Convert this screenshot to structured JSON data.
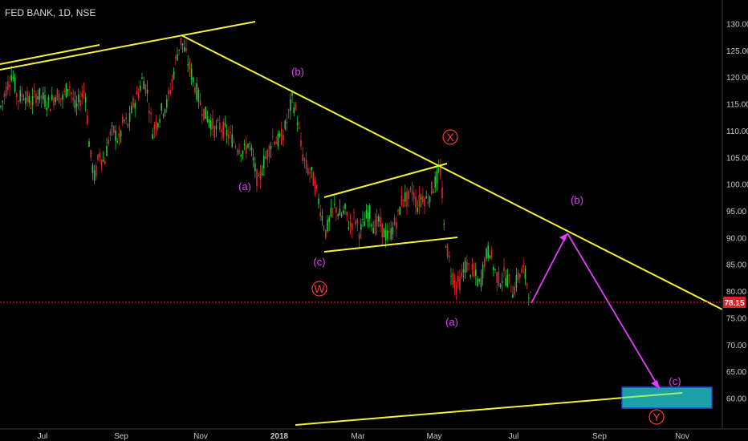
{
  "title": "FED BANK, 1D, NSE",
  "colors": {
    "background": "#000000",
    "bullish": "#26c637",
    "bearish": "#e0262c",
    "trendline": "#f2f23c",
    "projection": "#e040fb",
    "wave_circle": "#ff3b30",
    "target_box_fill": "#1b9fa8",
    "target_box_border": "#1f4fd6",
    "price_badge": "#e51f26"
  },
  "chart_data": {
    "type": "candlestick",
    "title": "FED BANK, 1D, NSE",
    "xlabel": "",
    "ylabel": "",
    "x_tick_labels": [
      "Jul",
      "Sep",
      "Nov",
      "2018",
      "Mar",
      "May",
      "Jul",
      "Sep",
      "Nov"
    ],
    "y_tick_labels": [
      "130.00",
      "125.00",
      "120.00",
      "115.00",
      "110.00",
      "105.00",
      "100.00",
      "95.00",
      "90.00",
      "85.00",
      "80.00",
      "75.00",
      "70.00",
      "65.00",
      "60.00"
    ],
    "ylim": [
      55,
      133
    ],
    "last_price": "78.15",
    "grid": false,
    "price_path": [
      [
        0,
        114
      ],
      [
        8,
        118
      ],
      [
        15,
        121
      ],
      [
        22,
        116
      ],
      [
        30,
        117
      ],
      [
        38,
        115
      ],
      [
        46,
        117
      ],
      [
        54,
        116
      ],
      [
        62,
        115
      ],
      [
        70,
        117
      ],
      [
        78,
        116
      ],
      [
        86,
        119
      ],
      [
        94,
        114
      ],
      [
        100,
        116
      ],
      [
        106,
        118
      ],
      [
        112,
        106
      ],
      [
        118,
        101
      ],
      [
        124,
        106
      ],
      [
        130,
        104
      ],
      [
        136,
        109
      ],
      [
        142,
        110
      ],
      [
        148,
        108
      ],
      [
        154,
        112
      ],
      [
        160,
        111
      ],
      [
        166,
        115
      ],
      [
        172,
        117
      ],
      [
        178,
        120
      ],
      [
        184,
        117
      ],
      [
        190,
        110
      ],
      [
        196,
        112
      ],
      [
        202,
        114
      ],
      [
        208,
        115
      ],
      [
        214,
        119
      ],
      [
        220,
        124
      ],
      [
        226,
        127
      ],
      [
        232,
        124
      ],
      [
        238,
        121
      ],
      [
        244,
        118
      ],
      [
        250,
        115
      ],
      [
        256,
        113
      ],
      [
        262,
        112
      ],
      [
        268,
        110
      ],
      [
        274,
        111
      ],
      [
        280,
        110
      ],
      [
        286,
        109
      ],
      [
        292,
        108
      ],
      [
        298,
        107
      ],
      [
        304,
        106
      ],
      [
        310,
        108
      ],
      [
        316,
        104
      ],
      [
        322,
        100
      ],
      [
        328,
        104
      ],
      [
        334,
        106
      ],
      [
        340,
        109
      ],
      [
        346,
        108
      ],
      [
        352,
        109
      ],
      [
        358,
        112
      ],
      [
        364,
        116
      ],
      [
        370,
        113
      ],
      [
        376,
        106
      ],
      [
        382,
        103
      ],
      [
        388,
        102
      ],
      [
        394,
        99
      ],
      [
        400,
        95
      ],
      [
        406,
        91
      ],
      [
        412,
        94
      ],
      [
        418,
        96
      ],
      [
        424,
        94
      ],
      [
        430,
        95
      ],
      [
        436,
        92
      ],
      [
        442,
        94
      ],
      [
        448,
        91
      ],
      [
        454,
        93
      ],
      [
        460,
        95
      ],
      [
        466,
        92
      ],
      [
        472,
        93
      ],
      [
        478,
        91
      ],
      [
        484,
        90
      ],
      [
        490,
        92
      ],
      [
        496,
        94
      ],
      [
        502,
        98
      ],
      [
        508,
        97
      ],
      [
        514,
        99
      ],
      [
        520,
        96
      ],
      [
        526,
        98
      ],
      [
        532,
        97
      ],
      [
        538,
        99
      ],
      [
        544,
        101
      ],
      [
        550,
        103
      ],
      [
        552,
        93
      ],
      [
        556,
        89
      ],
      [
        562,
        84
      ],
      [
        568,
        81
      ],
      [
        574,
        82
      ],
      [
        580,
        85
      ],
      [
        586,
        84
      ],
      [
        592,
        83
      ],
      [
        598,
        81
      ],
      [
        604,
        86
      ],
      [
        610,
        88
      ],
      [
        616,
        84
      ],
      [
        622,
        82
      ],
      [
        628,
        83
      ],
      [
        634,
        82
      ],
      [
        640,
        80
      ],
      [
        646,
        83
      ],
      [
        652,
        84
      ],
      [
        658,
        81
      ],
      [
        662,
        78
      ]
    ],
    "trendlines": [
      {
        "from": [
          "Jun '17",
          120.8
        ],
        "to": [
          "Jul '17",
          125.3
        ]
      },
      {
        "from": [
          "Jun '17",
          122.4
        ],
        "to": [
          "Oct '17",
          131.0
        ]
      },
      {
        "from": [
          "Oct '17",
          128.0
        ],
        "to": [
          "Dec '18",
          76.8
        ]
      },
      {
        "from": [
          "Feb '18",
          97.5
        ],
        "to": [
          "May '18",
          104.5
        ]
      },
      {
        "from": [
          "Feb '18",
          87.5
        ],
        "to": [
          "May '18",
          90.3
        ]
      },
      {
        "from": [
          "Jan '18",
          55.0
        ],
        "to": [
          "Oct '18",
          61.0
        ]
      }
    ],
    "projection": [
      {
        "date": "Jul '18",
        "price": 78.15
      },
      {
        "date": "Aug '18",
        "price": 91.0
      },
      {
        "date": "Oct '18",
        "price": 61.0
      }
    ],
    "target_zone": {
      "price_low": 58.0,
      "price_high": 62.0
    },
    "annotations": {
      "wave_labels": [
        "(b)",
        "(a)",
        "(c)",
        "(b)",
        "(a)",
        "(c)"
      ],
      "circle_labels": [
        "X",
        "W",
        "Y"
      ]
    }
  }
}
